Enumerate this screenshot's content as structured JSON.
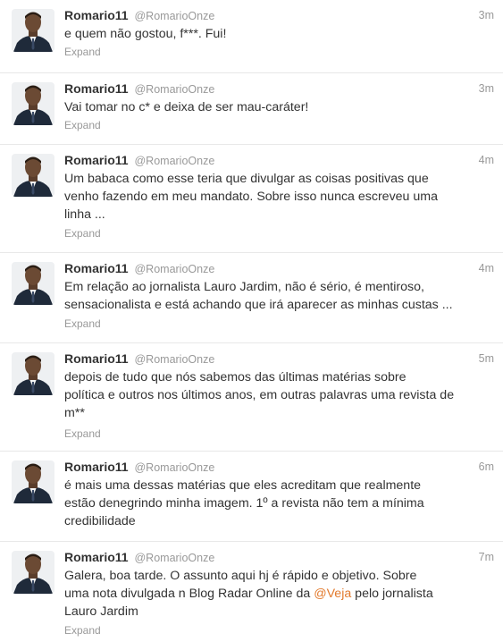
{
  "tweets": [
    {
      "name": "Romario11",
      "handle": "@RomarioOnze",
      "time": "3m",
      "text": "e quem não gostou, f***. Fui!",
      "expand": "Expand"
    },
    {
      "name": "Romario11",
      "handle": "@RomarioOnze",
      "time": "3m",
      "text": "Vai tomar no c* e deixa de ser mau-caráter!",
      "expand": "Expand"
    },
    {
      "name": "Romario11",
      "handle": "@RomarioOnze",
      "time": "4m",
      "lines": [
        "Um babaca como esse teria que divulgar as coisas positivas que",
        "venho fazendo em meu mandato. Sobre isso nunca escreveu uma",
        "linha ..."
      ],
      "expand": "Expand"
    },
    {
      "name": "Romario11",
      "handle": "@RomarioOnze",
      "time": "4m",
      "lines": [
        "Em relação ao jornalista Lauro Jardim, não é sério, é mentiroso,",
        "sensacionalista e está achando que irá aparecer as minhas custas ..."
      ],
      "expand": "Expand"
    },
    {
      "name": "Romario11",
      "handle": "@RomarioOnze",
      "time": "5m",
      "lines": [
        "depois de tudo que nós sabemos das últimas matérias sobre",
        "política e outros nos últimos anos, em outras palavras uma revista de",
        "m**"
      ],
      "expand": "Expand"
    },
    {
      "name": "Romario11",
      "handle": "@RomarioOnze",
      "time": "6m",
      "lines": [
        "é mais uma dessas matérias que eles acreditam que realmente",
        "estão denegrindo minha imagem. 1º a revista não tem a mínima",
        "credibilidade"
      ]
    },
    {
      "name": "Romario11",
      "handle": "@RomarioOnze",
      "time": "7m",
      "lines": [
        "Galera, boa tarde. O assunto aqui hj é rápido e objetivo. Sobre",
        "uma nota divulgada n Blog Radar Online da ",
        "@Veja",
        " pelo jornalista",
        "Lauro Jardim"
      ],
      "expand": "Expand"
    }
  ],
  "colors": {
    "mention": "#e27a2d",
    "meta": "#999999",
    "text": "#333333",
    "divider": "#e8e8e8"
  },
  "icons": {
    "avatar": "profile-photo"
  }
}
